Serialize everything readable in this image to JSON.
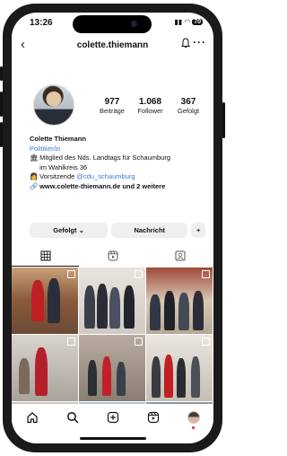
{
  "status_bar": {
    "time": "13:26",
    "battery": "70"
  },
  "header": {
    "username": "colette.thiemann",
    "back_glyph": "‹",
    "more_glyph": "···"
  },
  "profile": {
    "stats": [
      {
        "value": "977",
        "label": "Beiträge"
      },
      {
        "value": "1.068",
        "label": "Follower"
      },
      {
        "value": "367",
        "label": "Gefolgt"
      }
    ],
    "name": "Colette Thiemann",
    "category": "Politiker/in",
    "bio_lines": [
      {
        "icon": "🏛",
        "text": "Mitglied des Nds. Landtags für Schaumburg"
      },
      {
        "icon": "",
        "text": "im Wahlkreis 36"
      }
    ],
    "vorsitz": {
      "icon": "👩",
      "text": "Vorsitzende",
      "mention": "@cdu_schaumburg"
    },
    "website": {
      "icon": "🔗",
      "text": "www.colette-thiemann.de und 2 weitere"
    }
  },
  "actions": {
    "follow": "Gefolgt ⌄",
    "message": "Nachricht",
    "add_person": "+"
  },
  "tabs": [
    "posts-grid-icon",
    "reels-icon",
    "tagged-icon"
  ],
  "posts_count_visible": 9,
  "colors": {
    "link": "#3a7bd5",
    "button_bg": "#efefef",
    "notification_dot": "#e0245e"
  },
  "navbar": [
    "home-icon",
    "search-icon",
    "create-icon",
    "reels-icon",
    "profile-icon"
  ]
}
